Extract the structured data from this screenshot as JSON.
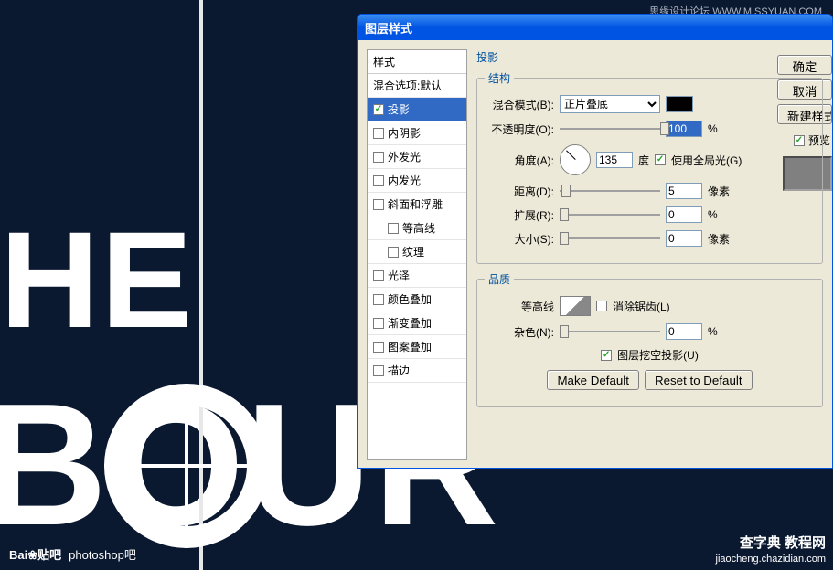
{
  "bg": {
    "the": "HE",
    "bour": "BOUR"
  },
  "watermarks": {
    "top_right": "思缘设计论坛  WWW.MISSYUAN.COM",
    "bl_logo": "Bai❀贴吧",
    "bl_text": "photoshop吧",
    "br_big": "查字典  教程网",
    "br_small": "jiaocheng.chazidian.com"
  },
  "dialog": {
    "title": "图层样式",
    "styles_header": "样式",
    "styles": {
      "blending": "混合选项:默认",
      "drop_shadow": "投影",
      "inner_shadow": "内阴影",
      "outer_glow": "外发光",
      "inner_glow": "内发光",
      "bevel": "斜面和浮雕",
      "contour": "等高线",
      "texture": "纹理",
      "satin": "光泽",
      "color_overlay": "颜色叠加",
      "gradient_overlay": "渐变叠加",
      "pattern_overlay": "图案叠加",
      "stroke": "描边"
    },
    "effect_title": "投影",
    "structure_legend": "结构",
    "quality_legend": "品质",
    "labels": {
      "blend_mode": "混合模式(B):",
      "opacity": "不透明度(O):",
      "angle": "角度(A):",
      "degree": "度",
      "global_light": "使用全局光(G)",
      "distance": "距离(D):",
      "spread": "扩展(R):",
      "size": "大小(S):",
      "px": "像素",
      "pct": "%",
      "contour": "等高线",
      "antialias": "消除锯齿(L)",
      "noise": "杂色(N):",
      "knockout": "图层挖空投影(U)"
    },
    "values": {
      "blend_mode": "正片叠底",
      "opacity": "100",
      "angle": "135",
      "distance": "5",
      "spread": "0",
      "size": "0",
      "noise": "0"
    },
    "buttons": {
      "ok": "确定",
      "cancel": "取消",
      "new_style": "新建样式(",
      "preview": "预览",
      "make_default": "Make Default",
      "reset_default": "Reset to Default"
    }
  }
}
